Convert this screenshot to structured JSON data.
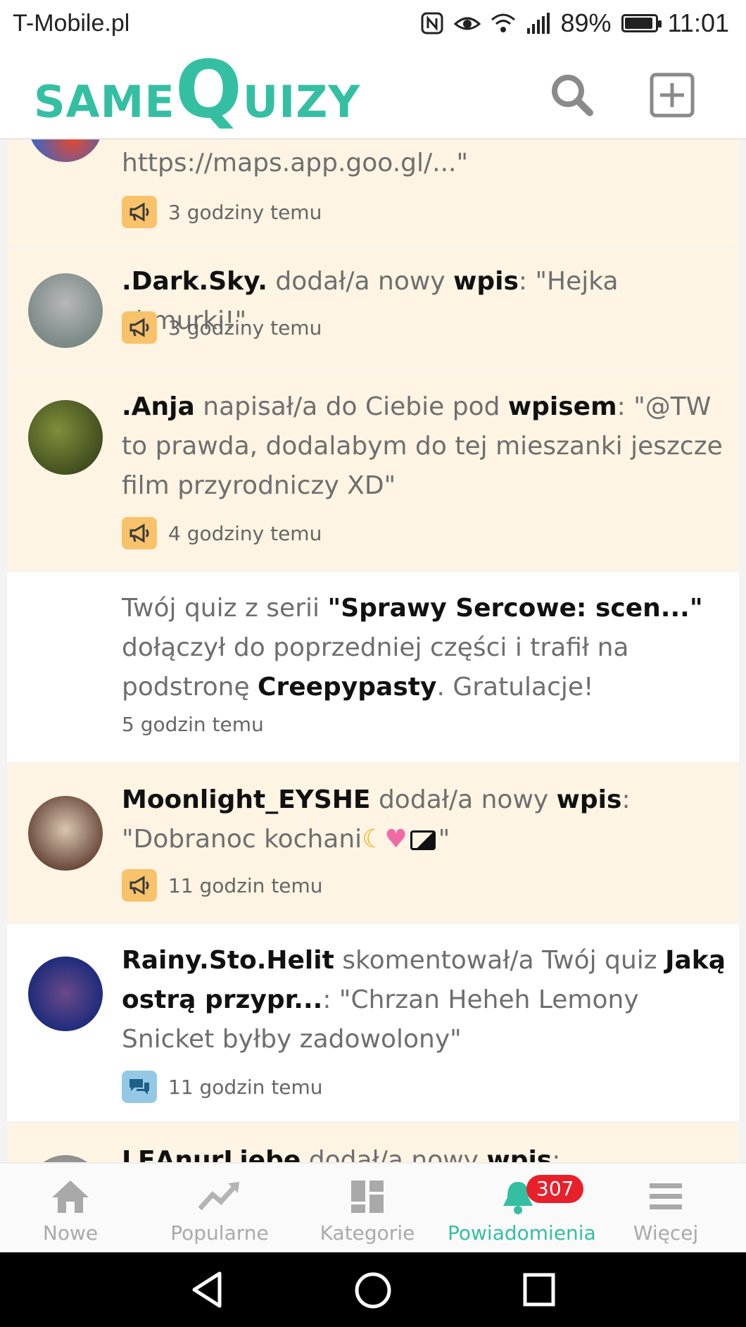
{
  "status_bar": {
    "carrier": "T-Mobile.pl",
    "battery": "89%",
    "battery_level": 0.89,
    "time": "11:01"
  },
  "app": {
    "logo_part1": "SAME",
    "logo_q": "Q",
    "logo_part2": "UIZY",
    "brand_color": "#34bfa3"
  },
  "notifications": [
    {
      "text": "https://maps.app.goo.gl/...\"",
      "time": "3 godziny temu",
      "icon": "megaphone-icon"
    },
    {
      "user": ".Dark.Sky.",
      "action": " dodał/a nowy ",
      "target": "wpis",
      "rest": ": \"Hejka chmurki!\"",
      "time": "3 godziny temu",
      "icon": "megaphone-icon"
    },
    {
      "user": ".Anja",
      "action": " napisał/a do Ciebie pod ",
      "target": "wpisem",
      "rest": ": \"@TW to prawda, dodalabym do tej mieszanki jeszcze film przyrodniczy XD\"",
      "time": "4 godziny temu",
      "icon": "megaphone-icon"
    },
    {
      "pre": "Twój quiz z serii ",
      "series": "\"Sprawy Sercowe: scen...\"",
      "mid": " dołączył do poprzedniej części i trafił na podstronę ",
      "page": "Creepypasty",
      "rest": ". Gratulacje!",
      "time": "5 godzin temu"
    },
    {
      "user": "Moonlight_EYSHE",
      "action": " dodał/a nowy ",
      "target": "wpis",
      "rest": ": \"Dobranoc kochani",
      "end": "\"",
      "time": "11 godzin temu",
      "icon": "megaphone-icon"
    },
    {
      "user": "Rainy.Sto.Helit",
      "action": " skomentował/a Twój quiz ",
      "target": "Jaką ostrą przypr...",
      "rest": ": \"Chrzan Heheh Lemony Snicket byłby zadowolony\"",
      "time": "11 godzin temu",
      "icon": "comment-icon"
    },
    {
      "user": "LEAnurLiebe",
      "action": " dodał/a nowy ",
      "target": "wpis",
      "rest": ":"
    }
  ],
  "bottom_nav": [
    {
      "label": "Nowe",
      "icon": "home-icon"
    },
    {
      "label": "Popularne",
      "icon": "trending-icon"
    },
    {
      "label": "Kategorie",
      "icon": "grid-icon"
    },
    {
      "label": "Powiadomienia",
      "icon": "bell-icon",
      "badge": "307",
      "active": true
    },
    {
      "label": "Więcej",
      "icon": "menu-icon"
    }
  ]
}
